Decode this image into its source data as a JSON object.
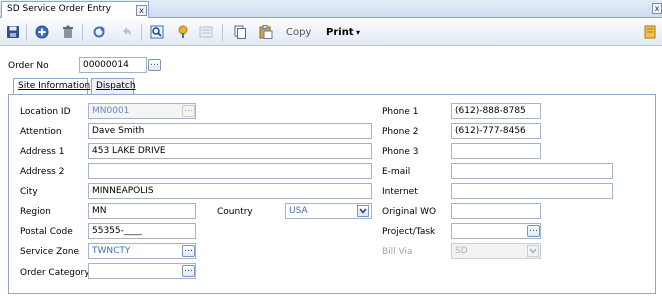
{
  "document_tab": {
    "title": "SD Service Order Entry",
    "close": "x"
  },
  "window": {
    "close": "x"
  },
  "toolbar": {
    "icons": [
      "save-icon",
      "add-icon",
      "delete-icon",
      "refresh-icon",
      "undo-icon",
      "zoom-icon",
      "pin-icon",
      "note-icon",
      "copy-icon",
      "paste-icon",
      "notebook-icon"
    ],
    "copy_label": "Copy",
    "print_label": "Print",
    "print_arrow": "▾"
  },
  "order": {
    "label": "Order No",
    "value": "00000014",
    "lookup": "…"
  },
  "tabs": [
    {
      "label": "Site Information",
      "active": true
    },
    {
      "label": "Dispatch",
      "active": false
    }
  ],
  "site": {
    "location_id": {
      "label": "Location ID",
      "value": "MN0001"
    },
    "attention": {
      "label": "Attention",
      "value": "Dave Smith"
    },
    "address1": {
      "label": "Address 1",
      "value": "453 LAKE DRIVE"
    },
    "address2": {
      "label": "Address 2",
      "value": ""
    },
    "city": {
      "label": "City",
      "value": "MINNEAPOLIS"
    },
    "region": {
      "label": "Region",
      "value": "MN"
    },
    "country": {
      "label": "Country",
      "value": "USA"
    },
    "postal_code": {
      "label": "Postal Code",
      "value": "55355-____"
    },
    "service_zone": {
      "label": "Service Zone",
      "value": "TWNCTY"
    },
    "order_category": {
      "label": "Order Category",
      "value": ""
    },
    "phone1": {
      "label": "Phone 1",
      "value": "(612)-888-8785"
    },
    "phone2": {
      "label": "Phone 2",
      "value": "(612)-777-8456"
    },
    "phone3": {
      "label": "Phone 3",
      "value": ""
    },
    "email": {
      "label": "E-mail",
      "value": ""
    },
    "internet": {
      "label": "Internet",
      "value": ""
    },
    "original_wo": {
      "label": "Original WO",
      "value": ""
    },
    "project_task": {
      "label": "Project/Task",
      "value": ""
    },
    "bill_via": {
      "label": "Bill Via",
      "value": "SD"
    }
  },
  "lookup_glyph": "…",
  "colors": {
    "accent": "#3f6fc4",
    "border": "#8fa6c8",
    "toolbar_bg": "#e3e9f3"
  }
}
